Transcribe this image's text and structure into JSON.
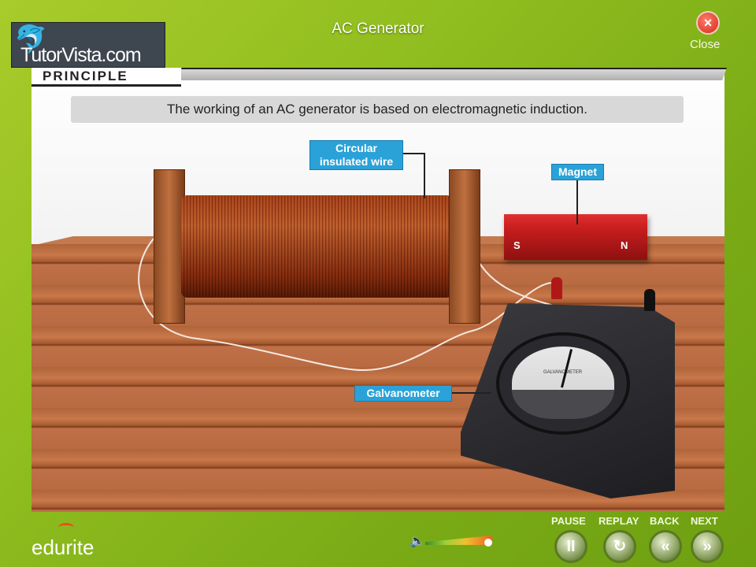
{
  "header": {
    "title": "AC Generator",
    "close_label": "Close",
    "close_icon": "×",
    "logo_text": "TutorVista.com"
  },
  "section": {
    "tab": "PRINCIPLE",
    "statement": "The working of an AC generator is based on electromagnetic induction."
  },
  "diagram": {
    "labels": {
      "coil": "Circular insulated wire",
      "magnet": "Magnet",
      "galvanometer": "Galvanometer"
    },
    "magnet_poles": {
      "south": "S",
      "north": "N"
    },
    "dial_text": "GALVANOMETER"
  },
  "footer": {
    "brand": "edurite",
    "controls": [
      {
        "label": "PAUSE",
        "icon": "II"
      },
      {
        "label": "REPLAY",
        "icon": "↻"
      },
      {
        "label": "BACK",
        "icon": "«"
      },
      {
        "label": "NEXT",
        "icon": "»"
      }
    ],
    "volume_icon": "🔈",
    "volume_level": 1.0
  }
}
